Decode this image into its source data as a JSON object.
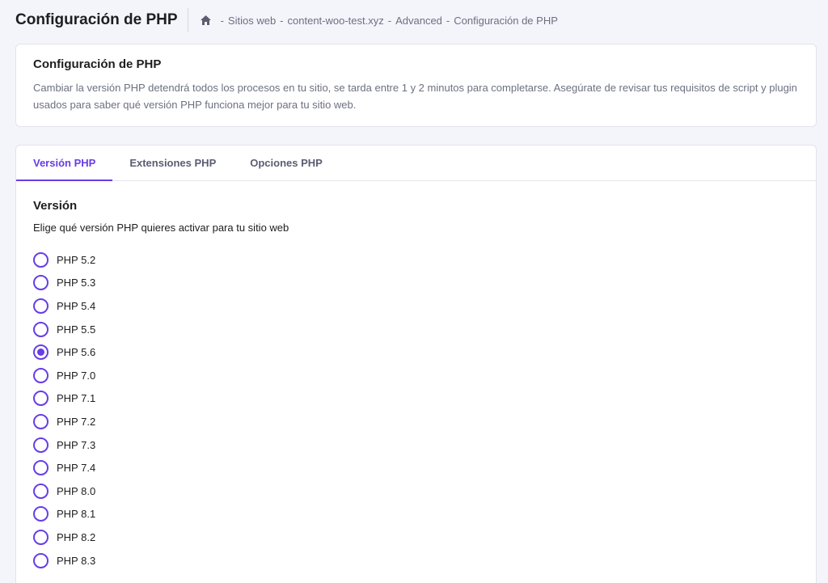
{
  "header": {
    "title": "Configuración de PHP",
    "breadcrumb": [
      {
        "label": "Sitios web"
      },
      {
        "label": "content-woo-test.xyz"
      },
      {
        "label": "Advanced"
      },
      {
        "label": "Configuración de PHP"
      }
    ],
    "separator": "-"
  },
  "info": {
    "title": "Configuración de PHP",
    "text": "Cambiar la versión PHP detendrá todos los procesos en tu sitio, se tarda entre 1 y 2 minutos para completarse. Asegúrate de revisar tus requisitos de script y plugin usados para saber qué versión PHP funciona mejor para tu sitio web."
  },
  "tabs": [
    {
      "label": "Versión PHP",
      "active": true
    },
    {
      "label": "Extensiones PHP",
      "active": false
    },
    {
      "label": "Opciones PHP",
      "active": false
    }
  ],
  "version": {
    "title": "Versión",
    "description": "Elige qué versión PHP quieres activar para tu sitio web",
    "selected": "PHP 5.6",
    "options": [
      "PHP 5.2",
      "PHP 5.3",
      "PHP 5.4",
      "PHP 5.5",
      "PHP 5.6",
      "PHP 7.0",
      "PHP 7.1",
      "PHP 7.2",
      "PHP 7.3",
      "PHP 7.4",
      "PHP 8.0",
      "PHP 8.1",
      "PHP 8.2",
      "PHP 8.3"
    ]
  },
  "colors": {
    "accent": "#673de6",
    "background": "#f4f4fb",
    "muted_text": "#6d7081"
  },
  "icons": {
    "home": "home-icon"
  }
}
